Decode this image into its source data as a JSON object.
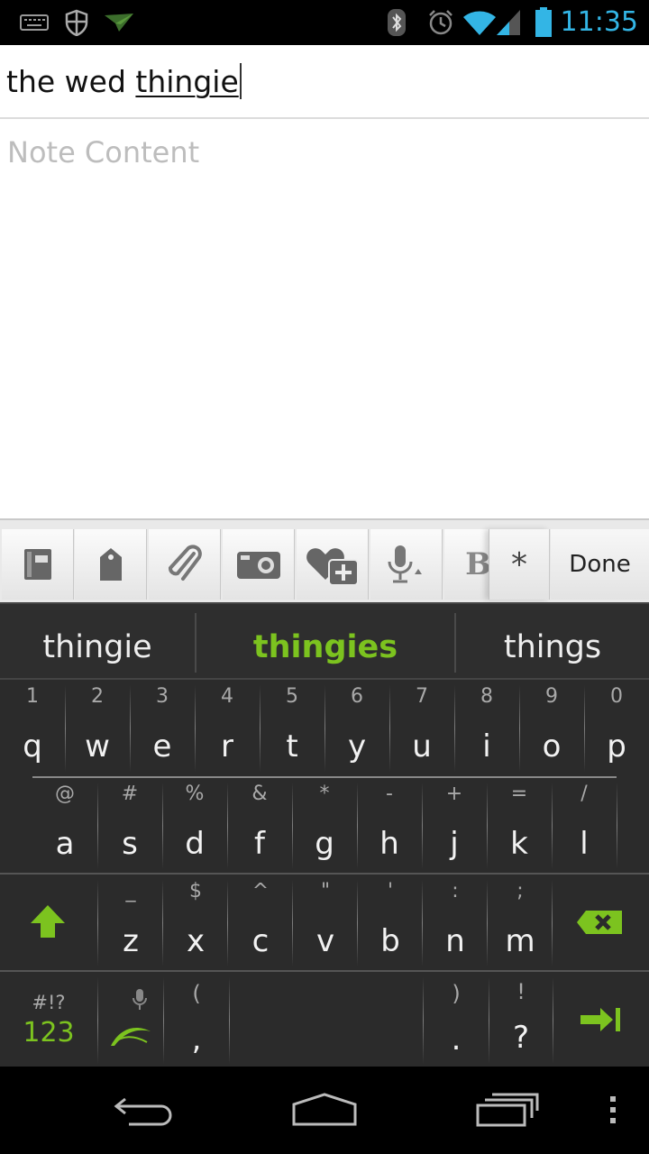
{
  "status_bar": {
    "time": "11:35",
    "accent_color": "#33b5e5",
    "icons_left": [
      "keyboard-icon",
      "shield-icon",
      "paper-plane-icon"
    ],
    "icons_right": [
      "bluetooth-icon",
      "alarm-icon",
      "wifi-icon",
      "signal-icon",
      "battery-icon"
    ]
  },
  "note": {
    "title_prefix": "the wed ",
    "title_composing": "thingie",
    "content_placeholder": "Note Content"
  },
  "toolbar": {
    "buttons": [
      "notebook-icon",
      "tag-icon",
      "paperclip-icon",
      "camera-icon",
      "heart-plus-icon",
      "microphone-icon",
      "bold-icon"
    ],
    "star_label": "*",
    "done_label": "Done"
  },
  "suggestions": {
    "left": "thingie",
    "center": "thingies",
    "right": "things",
    "highlight_color": "#7cc31f"
  },
  "keyboard": {
    "row1": [
      {
        "key": "q",
        "alt": "1"
      },
      {
        "key": "w",
        "alt": "2"
      },
      {
        "key": "e",
        "alt": "3"
      },
      {
        "key": "r",
        "alt": "4"
      },
      {
        "key": "t",
        "alt": "5"
      },
      {
        "key": "y",
        "alt": "6"
      },
      {
        "key": "u",
        "alt": "7"
      },
      {
        "key": "i",
        "alt": "8"
      },
      {
        "key": "o",
        "alt": "9"
      },
      {
        "key": "p",
        "alt": "0"
      }
    ],
    "row2": [
      {
        "key": "a",
        "alt": "@"
      },
      {
        "key": "s",
        "alt": "#"
      },
      {
        "key": "d",
        "alt": "%"
      },
      {
        "key": "f",
        "alt": "&"
      },
      {
        "key": "g",
        "alt": "*"
      },
      {
        "key": "h",
        "alt": "-"
      },
      {
        "key": "j",
        "alt": "+"
      },
      {
        "key": "k",
        "alt": "="
      },
      {
        "key": "l",
        "alt": "/"
      }
    ],
    "row3": [
      {
        "key": "z",
        "alt": "_"
      },
      {
        "key": "x",
        "alt": "$"
      },
      {
        "key": "c",
        "alt": "^"
      },
      {
        "key": "v",
        "alt": "\""
      },
      {
        "key": "b",
        "alt": "'"
      },
      {
        "key": "n",
        "alt": ":"
      },
      {
        "key": "m",
        "alt": ";"
      }
    ],
    "row4": {
      "symbols_alt": "#!?",
      "symbols_main": "123",
      "comma_alt": "(",
      "comma": ",",
      "period_alt": ")",
      "period": ".",
      "question_alt": "!",
      "question": "?"
    },
    "accent_color": "#7cc31f"
  },
  "nav_bar": {
    "icons": [
      "back-icon",
      "home-icon",
      "recents-icon",
      "menu-icon"
    ]
  }
}
